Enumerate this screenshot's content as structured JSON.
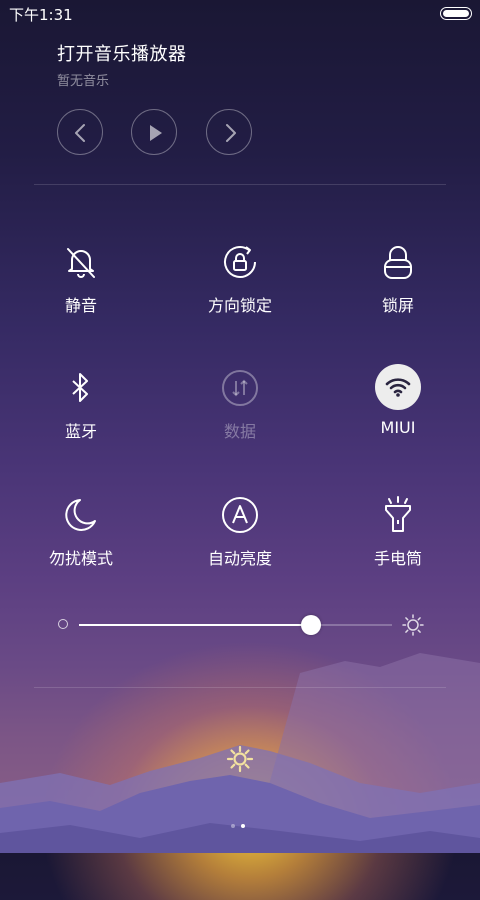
{
  "status_bar": {
    "time": "下午1:31",
    "battery_icon": "battery-full-icon"
  },
  "music": {
    "title": "打开音乐播放器",
    "subtitle": "暂无音乐",
    "controls": [
      "previous-icon",
      "play-icon",
      "next-icon"
    ]
  },
  "toggles": [
    {
      "label": "静音",
      "icon": "bell-off-icon",
      "active": false
    },
    {
      "label": "方向锁定",
      "icon": "rotation-lock-icon",
      "active": false
    },
    {
      "label": "锁屏",
      "icon": "lock-icon",
      "active": false
    },
    {
      "label": "蓝牙",
      "icon": "bluetooth-icon",
      "active": false
    },
    {
      "label": "数据",
      "icon": "mobile-data-icon",
      "active": false,
      "disabled": true
    },
    {
      "label": "MIUI",
      "icon": "wifi-icon",
      "active": true
    },
    {
      "label": "勿扰模式",
      "icon": "moon-icon",
      "active": false
    },
    {
      "label": "自动亮度",
      "icon": "auto-brightness-icon",
      "active": false
    },
    {
      "label": "手电筒",
      "icon": "flashlight-icon",
      "active": false
    }
  ],
  "brightness": {
    "level": 0.74
  },
  "pager": {
    "pages": 2,
    "current": 2
  },
  "colors": {
    "active_circle": "#ededed",
    "glow": "#ffd63c"
  }
}
